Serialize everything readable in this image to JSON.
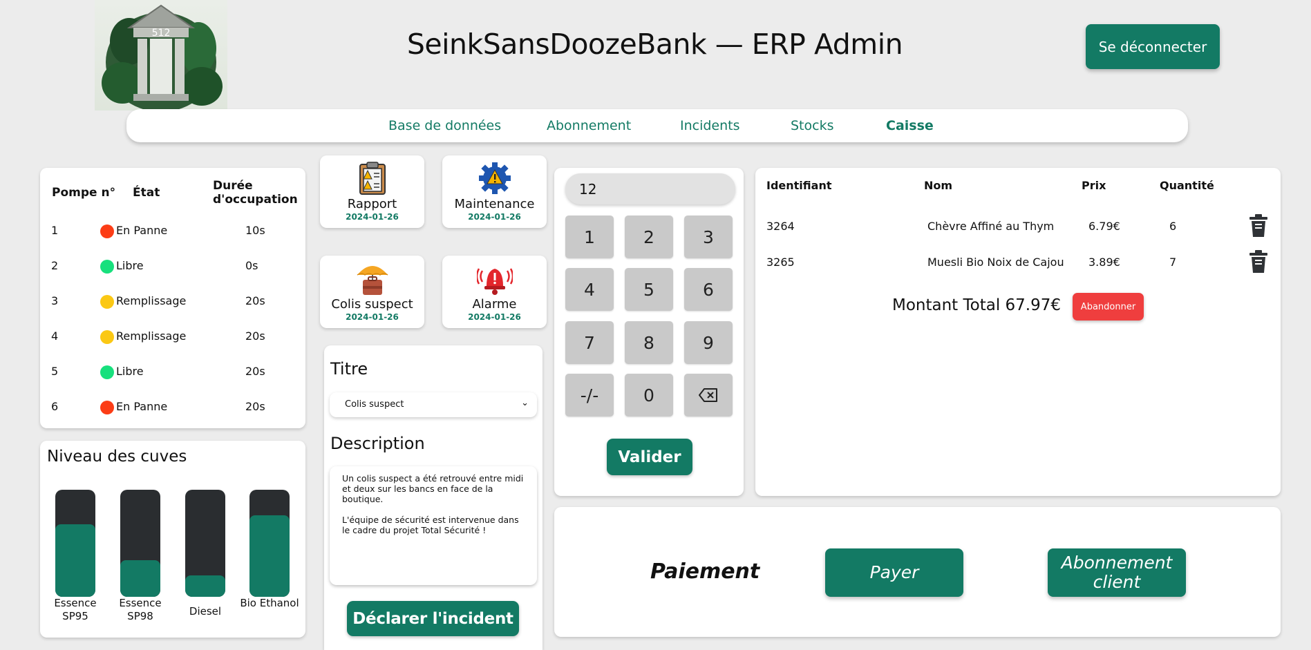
{
  "header": {
    "title": "SeinkSansDoozeBank — ERP Admin",
    "logo_number": "512",
    "logout_label": "Se déconnecter"
  },
  "nav": {
    "items": [
      {
        "label": "Base de données",
        "active": false
      },
      {
        "label": "Abonnement",
        "active": false
      },
      {
        "label": "Incidents",
        "active": false
      },
      {
        "label": "Stocks",
        "active": false
      },
      {
        "label": "Caisse",
        "active": true
      }
    ]
  },
  "pumps": {
    "headers": {
      "pump": "Pompe n°",
      "state": "État",
      "duration": "Durée d'occupation"
    },
    "rows": [
      {
        "id": "1",
        "state": "En Panne",
        "state_color": "#fc3d16",
        "duration": "10s"
      },
      {
        "id": "2",
        "state": "Libre",
        "state_color": "#17e07d",
        "duration": "0s"
      },
      {
        "id": "3",
        "state": "Remplissage",
        "state_color": "#fbc814",
        "duration": "20s"
      },
      {
        "id": "4",
        "state": "Remplissage",
        "state_color": "#fbc814",
        "duration": "20s"
      },
      {
        "id": "5",
        "state": "Libre",
        "state_color": "#17e07d",
        "duration": "20s"
      },
      {
        "id": "6",
        "state": "En Panne",
        "state_color": "#fc3d16",
        "duration": "20s"
      }
    ]
  },
  "tanks": {
    "title": "Niveau des cuves",
    "items": [
      {
        "label": "Essence SP95",
        "level": 0.68
      },
      {
        "label": "Essence SP98",
        "level": 0.34
      },
      {
        "label": "Diesel",
        "level": 0.2
      },
      {
        "label": "Bio Ethanol",
        "level": 0.76
      }
    ]
  },
  "incidents": {
    "cards": [
      {
        "label": "Rapport",
        "date": "2024-01-26",
        "icon": "clipboard-warning-icon"
      },
      {
        "label": "Maintenance",
        "date": "2024-01-26",
        "icon": "gear-warning-icon"
      },
      {
        "label": "Colis suspect",
        "date": "2024-01-26",
        "icon": "umbrella-package-icon"
      },
      {
        "label": "Alarme",
        "date": "2024-01-26",
        "icon": "alarm-bell-icon"
      }
    ],
    "form": {
      "title_label": "Titre",
      "selected": "Colis suspect",
      "description_label": "Description",
      "description": "Un colis suspect a été retrouvé entre midi et deux sur les bancs en face de la boutique.\n\nL'équipe de sécurité est intervenue dans le cadre du projet Total Sécurité !",
      "submit_label": "Déclarer l'incident"
    }
  },
  "keypad": {
    "display": "12",
    "keys": [
      "1",
      "2",
      "3",
      "4",
      "5",
      "6",
      "7",
      "8",
      "9",
      "-/-",
      "0",
      "⌫"
    ],
    "validate_label": "Valider"
  },
  "cart": {
    "headers": {
      "id": "Identifiant",
      "name": "Nom",
      "price": "Prix",
      "qty": "Quantité"
    },
    "rows": [
      {
        "id": "3264",
        "name": "Chèvre Affiné au Thym",
        "price": "6.79€",
        "qty": "6"
      },
      {
        "id": "3265",
        "name": "Muesli Bio Noix de Cajou",
        "price": "3.89€",
        "qty": "7"
      }
    ],
    "total": "Montant Total 67.97€",
    "abandon_label": "Abandonner"
  },
  "payment": {
    "title": "Paiement",
    "pay_label": "Payer",
    "subscription_label": "Abonnement client"
  },
  "colors": {
    "accent": "#137a64",
    "danger": "#ef3e3e",
    "tank_empty": "#2a2d30",
    "background": "#ececec"
  }
}
